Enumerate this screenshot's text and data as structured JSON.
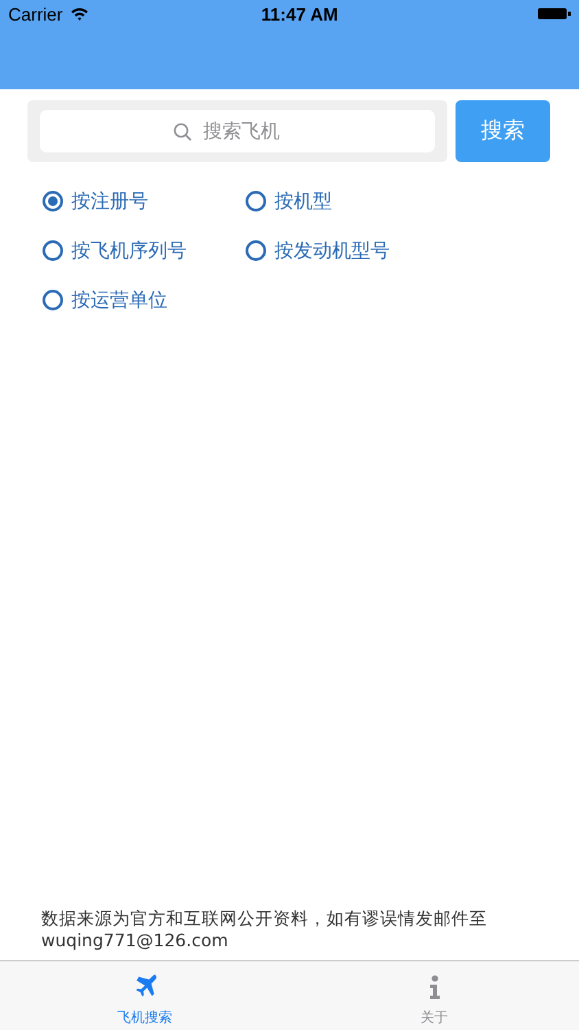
{
  "status_bar": {
    "carrier": "Carrier",
    "time": "11:47 AM"
  },
  "search": {
    "placeholder": "搜索飞机",
    "button": "搜索"
  },
  "options": [
    {
      "label": "按注册号",
      "selected": true
    },
    {
      "label": "按机型",
      "selected": false
    },
    {
      "label": "按飞机序列号",
      "selected": false
    },
    {
      "label": "按发动机型号",
      "selected": false
    },
    {
      "label": "按运营单位",
      "selected": false
    }
  ],
  "footer": {
    "note": "数据来源为官方和互联网公开资料，如有谬误情发邮件至",
    "email": "wuqing771@126.com"
  },
  "tabs": [
    {
      "label": "飞机搜索",
      "kind": "plane",
      "selected": true
    },
    {
      "label": "关于",
      "kind": "info",
      "selected": false
    }
  ]
}
